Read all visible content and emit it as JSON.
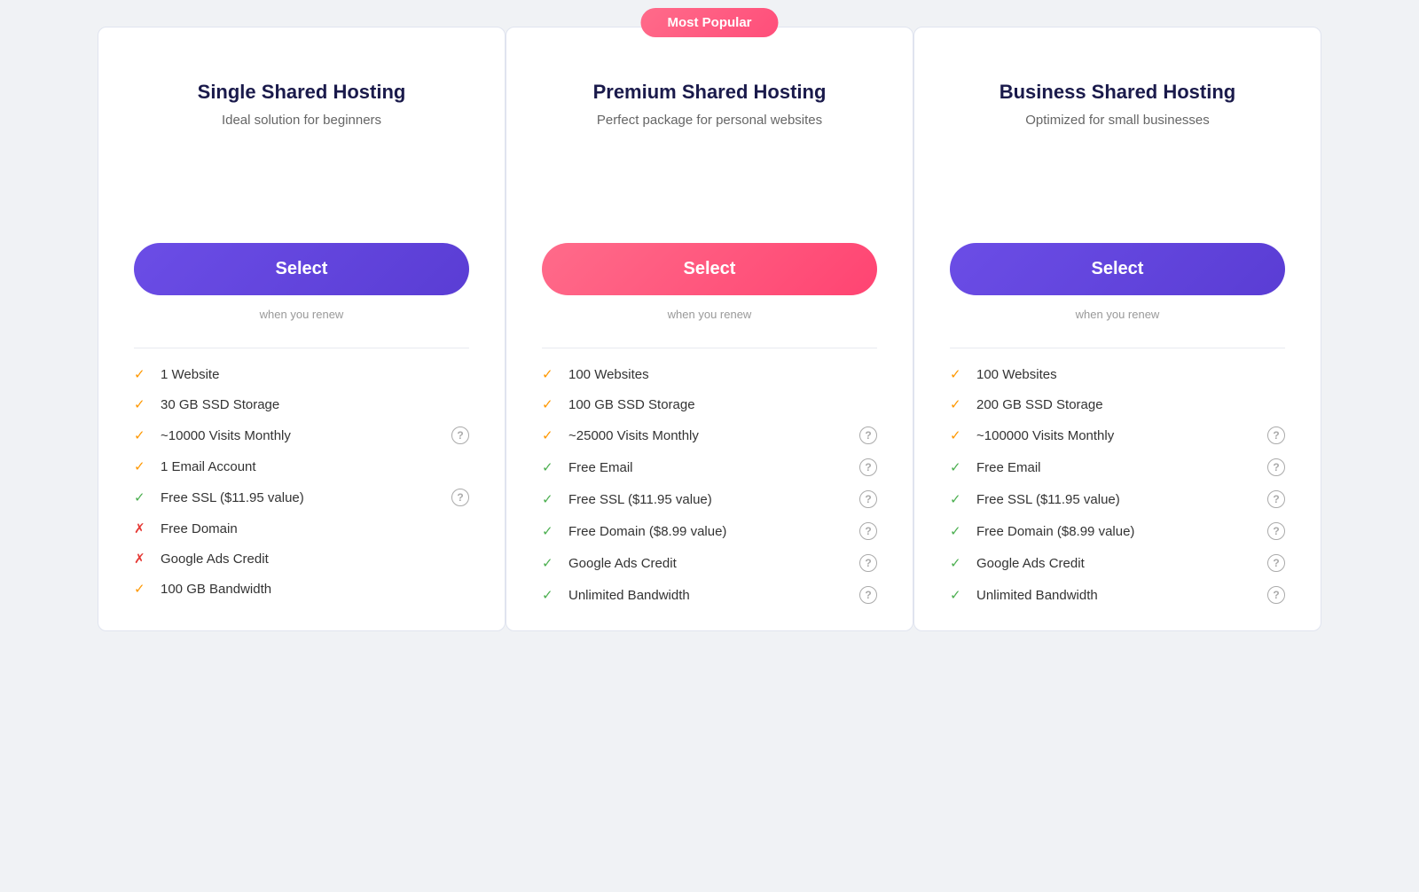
{
  "plans": [
    {
      "id": "single",
      "title": "Single Shared Hosting",
      "subtitle": "Ideal solution for beginners",
      "popular": false,
      "popular_badge": "",
      "select_label": "Select",
      "select_style": "purple",
      "renew_text": "when you renew",
      "features": [
        {
          "icon": "check-orange",
          "text": "1 Website",
          "help": false
        },
        {
          "icon": "check-orange",
          "text": "30 GB SSD Storage",
          "help": false
        },
        {
          "icon": "check-orange",
          "text": "~10000 Visits Monthly",
          "help": true
        },
        {
          "icon": "check-orange",
          "text": "1 Email Account",
          "help": false
        },
        {
          "icon": "check-green",
          "text": "Free SSL ($11.95 value)",
          "help": true
        },
        {
          "icon": "cross-red",
          "text": "Free Domain",
          "help": false
        },
        {
          "icon": "cross-red",
          "text": "Google Ads Credit",
          "help": false
        },
        {
          "icon": "check-orange",
          "text": "100 GB Bandwidth",
          "help": false
        }
      ]
    },
    {
      "id": "premium",
      "title": "Premium Shared Hosting",
      "subtitle": "Perfect package for personal websites",
      "popular": true,
      "popular_badge": "Most Popular",
      "select_label": "Select",
      "select_style": "pink",
      "renew_text": "when you renew",
      "features": [
        {
          "icon": "check-orange",
          "text": "100 Websites",
          "help": false
        },
        {
          "icon": "check-orange",
          "text": "100 GB SSD Storage",
          "help": false
        },
        {
          "icon": "check-orange",
          "text": "~25000 Visits Monthly",
          "help": true
        },
        {
          "icon": "check-green",
          "text": "Free Email",
          "help": true
        },
        {
          "icon": "check-green",
          "text": "Free SSL ($11.95 value)",
          "help": true
        },
        {
          "icon": "check-green",
          "text": "Free Domain ($8.99 value)",
          "help": true
        },
        {
          "icon": "check-green",
          "text": "Google Ads Credit",
          "help": true
        },
        {
          "icon": "check-green",
          "text": "Unlimited Bandwidth",
          "help": true
        }
      ]
    },
    {
      "id": "business",
      "title": "Business Shared Hosting",
      "subtitle": "Optimized for small businesses",
      "popular": false,
      "popular_badge": "",
      "select_label": "Select",
      "select_style": "purple",
      "renew_text": "when you renew",
      "features": [
        {
          "icon": "check-orange",
          "text": "100 Websites",
          "help": false
        },
        {
          "icon": "check-orange",
          "text": "200 GB SSD Storage",
          "help": false
        },
        {
          "icon": "check-orange",
          "text": "~100000 Visits Monthly",
          "help": true
        },
        {
          "icon": "check-green",
          "text": "Free Email",
          "help": true
        },
        {
          "icon": "check-green",
          "text": "Free SSL ($11.95 value)",
          "help": true
        },
        {
          "icon": "check-green",
          "text": "Free Domain ($8.99 value)",
          "help": true
        },
        {
          "icon": "check-green",
          "text": "Google Ads Credit",
          "help": true
        },
        {
          "icon": "check-green",
          "text": "Unlimited Bandwidth",
          "help": true
        }
      ]
    }
  ]
}
